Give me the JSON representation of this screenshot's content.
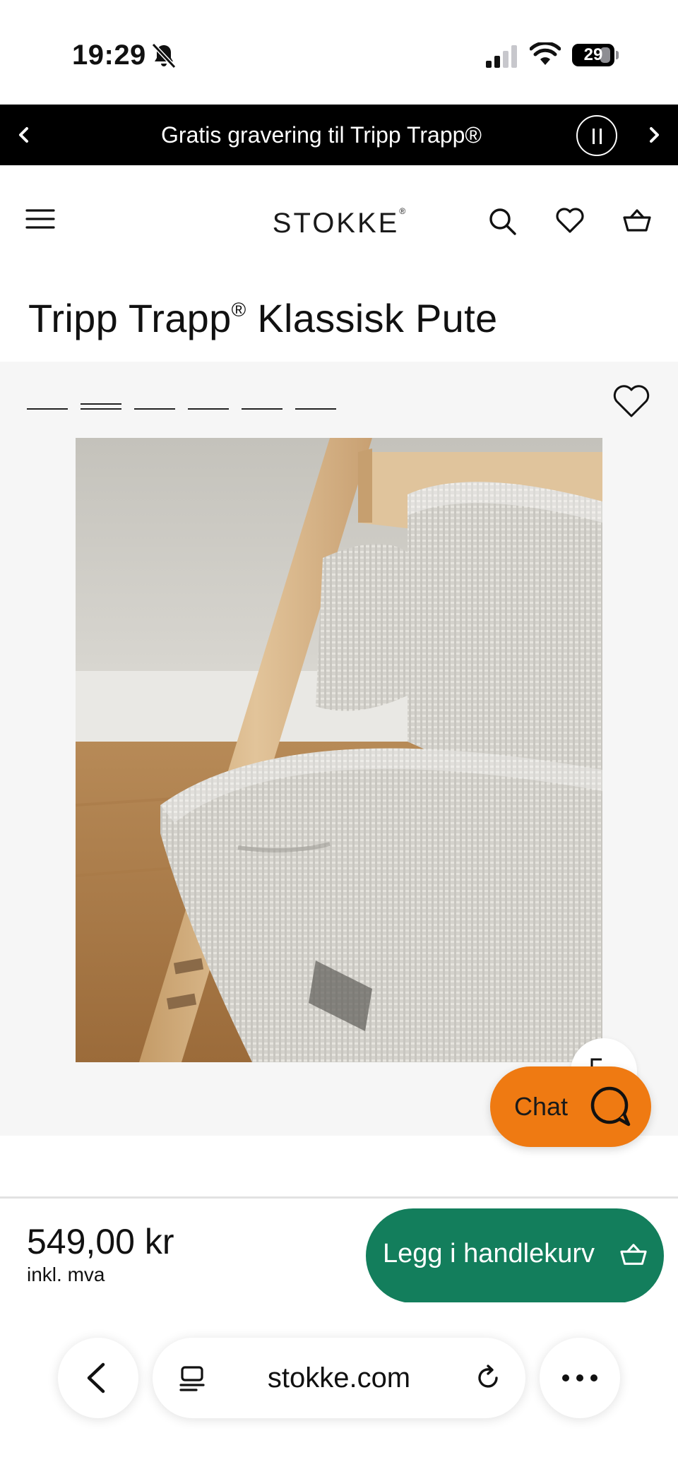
{
  "status_bar": {
    "time": "19:29",
    "battery": "29",
    "battery_level": 0.29,
    "icons": [
      "bell-slash-icon",
      "signal-icon",
      "wifi-icon",
      "battery-icon"
    ]
  },
  "promo": {
    "text": "Gratis gravering til Tripp Trapp®",
    "icons": [
      "chevron-left-icon",
      "pause-icon",
      "chevron-right-icon"
    ]
  },
  "header": {
    "logo": "STOKKE",
    "logo_mark": "®",
    "icons": [
      "menu-icon",
      "search-icon",
      "heart-icon",
      "basket-icon"
    ]
  },
  "product": {
    "title": "Tripp Trapp",
    "title_mark": "®",
    "title_rest": " Klassisk Pute",
    "image_count": 6,
    "active_image": 2,
    "image_subject": "grey cushion on wooden Tripp Trapp chair"
  },
  "chat": {
    "label": "Chat"
  },
  "purchase": {
    "price": "549,00 kr",
    "price_note": "inkl. mva",
    "add_to_cart": "Legg i handlekurv"
  },
  "browser": {
    "url": "stokke.com",
    "icons": [
      "back-icon",
      "reader-icon",
      "reload-icon",
      "more-icon"
    ]
  },
  "colors": {
    "promo_bg": "#000000",
    "chat_orange": "#ef7a12",
    "cart_green": "#137e5c",
    "gallery_bg": "#f6f6f6"
  }
}
